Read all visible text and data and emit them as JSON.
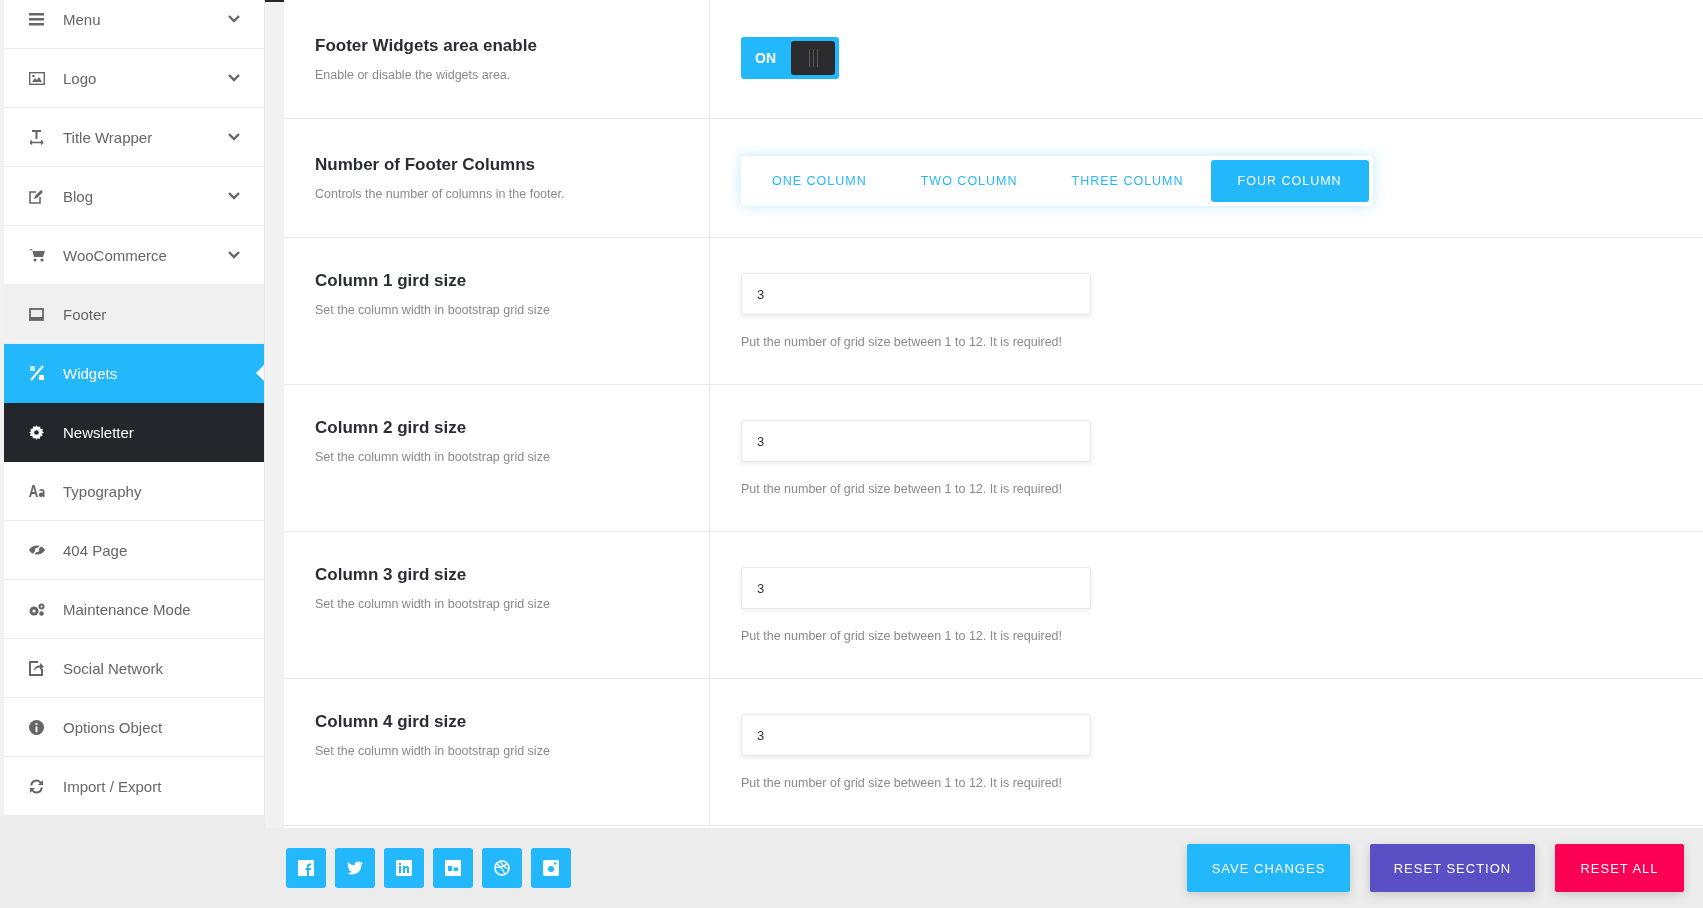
{
  "sidebar": {
    "items": [
      {
        "label": "Menu",
        "has_submenu": true,
        "selected": false,
        "expanded": false,
        "hovered": false
      },
      {
        "label": "Logo",
        "has_submenu": true,
        "selected": false,
        "expanded": false,
        "hovered": false
      },
      {
        "label": "Title Wrapper",
        "has_submenu": true,
        "selected": false,
        "expanded": false,
        "hovered": false
      },
      {
        "label": "Blog",
        "has_submenu": true,
        "selected": false,
        "expanded": false,
        "hovered": false
      },
      {
        "label": "WooCommerce",
        "has_submenu": true,
        "selected": false,
        "expanded": false,
        "hovered": false
      },
      {
        "label": "Footer",
        "has_submenu": false,
        "selected": false,
        "expanded": true,
        "hovered": false
      },
      {
        "label": "Widgets",
        "has_submenu": false,
        "selected": true,
        "expanded": false,
        "hovered": false
      },
      {
        "label": "Newsletter",
        "has_submenu": false,
        "selected": false,
        "expanded": false,
        "hovered": true
      },
      {
        "label": "Typography",
        "has_submenu": false,
        "selected": false,
        "expanded": false,
        "hovered": false
      },
      {
        "label": "404 Page",
        "has_submenu": false,
        "selected": false,
        "expanded": false,
        "hovered": false
      },
      {
        "label": "Maintenance Mode",
        "has_submenu": false,
        "selected": false,
        "expanded": false,
        "hovered": false
      },
      {
        "label": "Social Network",
        "has_submenu": false,
        "selected": false,
        "expanded": false,
        "hovered": false
      },
      {
        "label": "Options Object",
        "has_submenu": false,
        "selected": false,
        "expanded": false,
        "hovered": false
      },
      {
        "label": "Import / Export",
        "has_submenu": false,
        "selected": false,
        "expanded": false,
        "hovered": false
      }
    ]
  },
  "settings": [
    {
      "kind": "toggle",
      "title": "Footer Widgets area enable",
      "description": "Enable or disable the widgets area.",
      "on": true,
      "toggle_label": "ON"
    },
    {
      "kind": "segmented",
      "title": "Number of Footer Columns",
      "description": "Controls the number of columns in the footer.",
      "options": [
        {
          "label": "ONE COLUMN",
          "selected": false
        },
        {
          "label": "TWO COLUMN",
          "selected": false
        },
        {
          "label": "THREE COLUMN",
          "selected": false
        },
        {
          "label": "FOUR COLUMN",
          "selected": true
        }
      ]
    },
    {
      "kind": "number",
      "title": "Column 1 gird size",
      "description": "Set the column width in bootstrap grid size",
      "value": "3",
      "hint": "Put the number of grid size between 1 to 12. It is required!"
    },
    {
      "kind": "number",
      "title": "Column 2 gird size",
      "description": "Set the column width in bootstrap grid size",
      "value": "3",
      "hint": "Put the number of grid size between 1 to 12. It is required!"
    },
    {
      "kind": "number",
      "title": "Column 3 gird size",
      "description": "Set the column width in bootstrap grid size",
      "value": "3",
      "hint": "Put the number of grid size between 1 to 12. It is required!"
    },
    {
      "kind": "number",
      "title": "Column 4 gird size",
      "description": "Set the column width in bootstrap grid size",
      "value": "3",
      "hint": "Put the number of grid size between 1 to 12. It is required!"
    }
  ],
  "footer": {
    "buttons": [
      {
        "label": "SAVE CHANGES",
        "kind": "save"
      },
      {
        "label": "RESET SECTION",
        "kind": "reset"
      },
      {
        "label": "RESET ALL",
        "kind": "danger"
      }
    ]
  }
}
